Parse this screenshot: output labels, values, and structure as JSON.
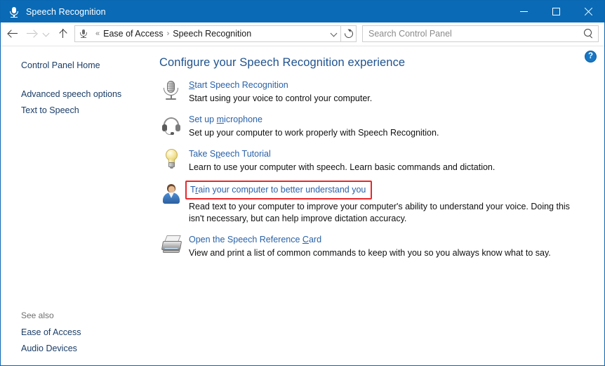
{
  "window": {
    "title": "Speech Recognition",
    "title_icon": "microphone-icon",
    "minimize_label": "Minimize",
    "maximize_label": "Maximize",
    "close_label": "Close"
  },
  "addressbar": {
    "back_label": "Back",
    "forward_label": "Forward",
    "recent_label": "Recent locations",
    "up_label": "Up one level",
    "breadcrumb_icon": "microphone-icon",
    "breadcrumb_prefix": "«",
    "breadcrumb": [
      {
        "label": "Ease of Access"
      },
      {
        "label": "Speech Recognition"
      }
    ],
    "breadcrumb_separator": "›",
    "dropdown_label": "Previous locations",
    "refresh_label": "Refresh"
  },
  "search": {
    "placeholder": "Search Control Panel",
    "value": "",
    "icon": "search-icon"
  },
  "sidebar": {
    "home_label": "Control Panel Home",
    "items": [
      {
        "label": "Advanced speech options"
      },
      {
        "label": "Text to Speech"
      }
    ],
    "see_also_title": "See also",
    "see_also": [
      {
        "label": "Ease of Access"
      },
      {
        "label": "Audio Devices"
      }
    ]
  },
  "content": {
    "help_icon": "help-question-icon",
    "help_glyph": "?",
    "page_title": "Configure your Speech Recognition experience",
    "tasks": [
      {
        "icon": "microphone-icon",
        "link_pre": "",
        "link_accel": "S",
        "link_post": "tart Speech Recognition",
        "link_full": "Start Speech Recognition",
        "desc": "Start using your voice to control your computer.",
        "highlighted": false
      },
      {
        "icon": "headset-icon",
        "link_pre": "Set up ",
        "link_accel": "m",
        "link_post": "icrophone",
        "link_full": "Set up microphone",
        "desc": "Set up your computer to work properly with Speech Recognition.",
        "highlighted": false
      },
      {
        "icon": "lightbulb-icon",
        "link_pre": "Take S",
        "link_accel": "p",
        "link_post": "eech Tutorial",
        "link_full": "Take Speech Tutorial",
        "desc": "Learn to use your computer with speech.  Learn basic commands and dictation.",
        "highlighted": false
      },
      {
        "icon": "person-icon",
        "link_pre": "T",
        "link_accel": "r",
        "link_post": "ain your computer to better understand you",
        "link_full": "Train your computer to better understand you",
        "desc": "Read text to your computer to improve your computer's ability to understand your voice.  Doing this isn't necessary, but can help improve dictation accuracy.",
        "highlighted": true
      },
      {
        "icon": "printer-icon",
        "link_pre": "Open the Speech Reference ",
        "link_accel": "C",
        "link_post": "ard",
        "link_full": "Open the Speech Reference Card",
        "desc": "View and print a list of common commands to keep with you so you always know what to say.",
        "highlighted": false
      }
    ]
  },
  "colors": {
    "titlebar": "#0a6ab5",
    "link": "#2a62a8",
    "heading": "#20538f",
    "highlight_box": "#e8272b",
    "help_icon": "#1877c4"
  }
}
